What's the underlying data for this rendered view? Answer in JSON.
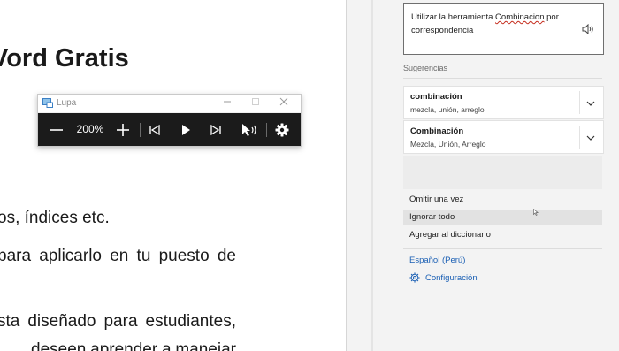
{
  "document": {
    "heading": "Vord Gratis",
    "lines": [
      "os, índices etc.",
      [
        "para",
        "aplicarlo",
        "en",
        "tu",
        "puesto",
        "de"
      ],
      [
        "sta",
        "diseñado",
        "para",
        "estudiantes,"
      ],
      [
        "deseen",
        "aprender",
        "a",
        "manejar"
      ]
    ]
  },
  "magnifier": {
    "title": "Lupa",
    "zoom": "200%",
    "icons": [
      "magnifier-app-icon",
      "minus-icon",
      "plus-icon",
      "previous-icon",
      "play-icon",
      "next-icon",
      "read-from-here-icon",
      "gear-icon"
    ]
  },
  "editor_pane": {
    "context_text_before": "Utilizar la herramienta ",
    "context_error_word": "Combinacion",
    "context_text_after": " por correspondencia",
    "suggestions_label": "Sugerencias",
    "suggestions": [
      {
        "word": "combinación",
        "synonyms": "mezcla, unión, arreglo"
      },
      {
        "word": "Combinación",
        "synonyms": "Mezcla, Unión, Arreglo"
      }
    ],
    "actions": {
      "ignore_once": "Omitir una vez",
      "ignore_all": "Ignorar todo",
      "add_dictionary": "Agregar al diccionario"
    },
    "language": "Español (Perú)",
    "settings": "Configuración"
  },
  "colors": {
    "link": "#1a5fb4",
    "error_underline": "#c42b1c",
    "toolbar": "#1b1b1b"
  }
}
